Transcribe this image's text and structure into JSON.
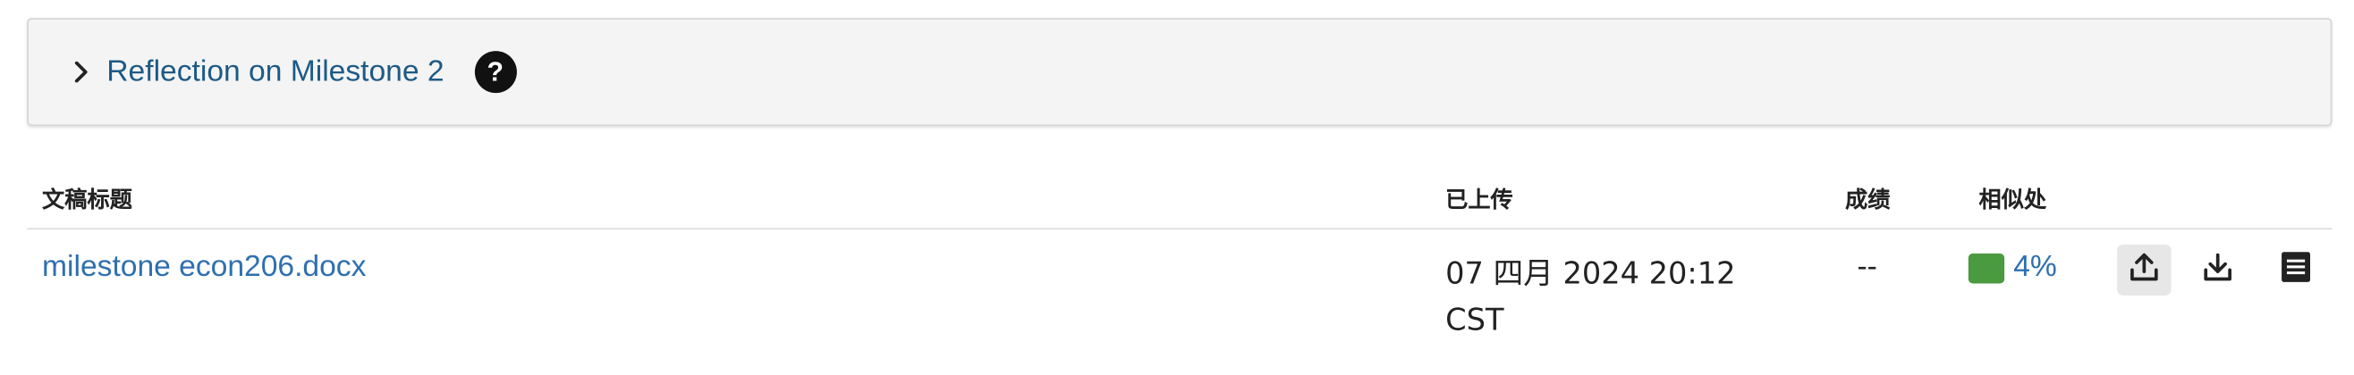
{
  "assignment": {
    "title": "Reflection on Milestone 2",
    "help_icon": "question-circle-icon",
    "toggle_icon": "chevron-right-icon"
  },
  "table": {
    "headers": {
      "title": "文稿标题",
      "uploaded": "已上传",
      "grade": "成绩",
      "similarity": "相似处"
    },
    "rows": [
      {
        "title": "milestone econ206.docx",
        "uploaded_line1": "07 四月 2024 20:12",
        "uploaded_line2": "CST",
        "grade": "--",
        "similarity": "4%",
        "similarity_color": "#4a9a3f",
        "actions": [
          "upload-icon",
          "download-icon",
          "details-icon"
        ]
      }
    ]
  },
  "colors": {
    "link": "#2f6fae",
    "panel_bg": "#f4f4f4"
  }
}
